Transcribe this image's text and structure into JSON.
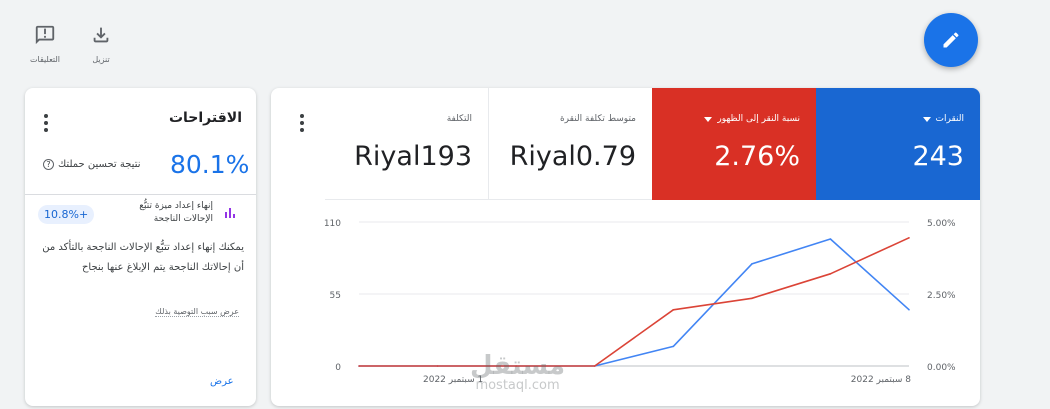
{
  "toolbar": {
    "feedback_label": "التعليقات",
    "download_label": "تنزيل"
  },
  "recommendations": {
    "title": "الاقتراحات",
    "optimization_score": "80.1%",
    "optimization_label": "نتيجة تحسين حملتك",
    "item": {
      "uplift": "10.8%+",
      "title": "إنهاء إعداد ميزة تتبُّع الإحالات الناجحة",
      "description": "يمكنك إنهاء إعداد تتبُّع الإحالات الناجحة بالتأكد من أن إحالاتك الناجحة يتم الإبلاغ عنها بنجاح",
      "reason_link": "عرض سبب التوصية بذلك"
    },
    "view_link": "عرض"
  },
  "metrics": {
    "cost": {
      "label": "التكلفة",
      "value": "Riyal193"
    },
    "avg_cpc": {
      "label": "متوسط تكلفة النقرة",
      "value": "Riyal0.79"
    },
    "ctr": {
      "label": "نسبة النقر إلى الظهور",
      "value": "2.76%",
      "color": "#d93025"
    },
    "clicks": {
      "label": "النقرات",
      "value": "243",
      "color": "#1967d2"
    }
  },
  "chart_data": {
    "type": "line",
    "x": [
      "1 سبتمبر 2022",
      "2022-09-02",
      "2022-09-03",
      "2022-09-04",
      "2022-09-05",
      "2022-09-06",
      "2022-09-07",
      "8 سبتمبر 2022"
    ],
    "x_tick_labels": [
      "1 سبتمبر 2022",
      "8 سبتمبر 2022"
    ],
    "y_left_ticks": [
      "0",
      "55",
      "110"
    ],
    "y_right_ticks": [
      "0.00%",
      "2.50%",
      "5.00%"
    ],
    "y_left_range": [
      0,
      110
    ],
    "y_right_range": [
      0,
      5
    ],
    "grid": true,
    "series": [
      {
        "color": "#4285f4",
        "axis": "left",
        "values": [
          0,
          0,
          0,
          0,
          15,
          78,
          97,
          43
        ]
      },
      {
        "color": "#db4437",
        "axis": "right",
        "values": [
          0,
          0,
          0,
          0,
          1.95,
          2.35,
          3.2,
          4.45
        ]
      }
    ]
  },
  "watermark": {
    "arabic": "مستقل",
    "latin": "mostaql.com"
  }
}
